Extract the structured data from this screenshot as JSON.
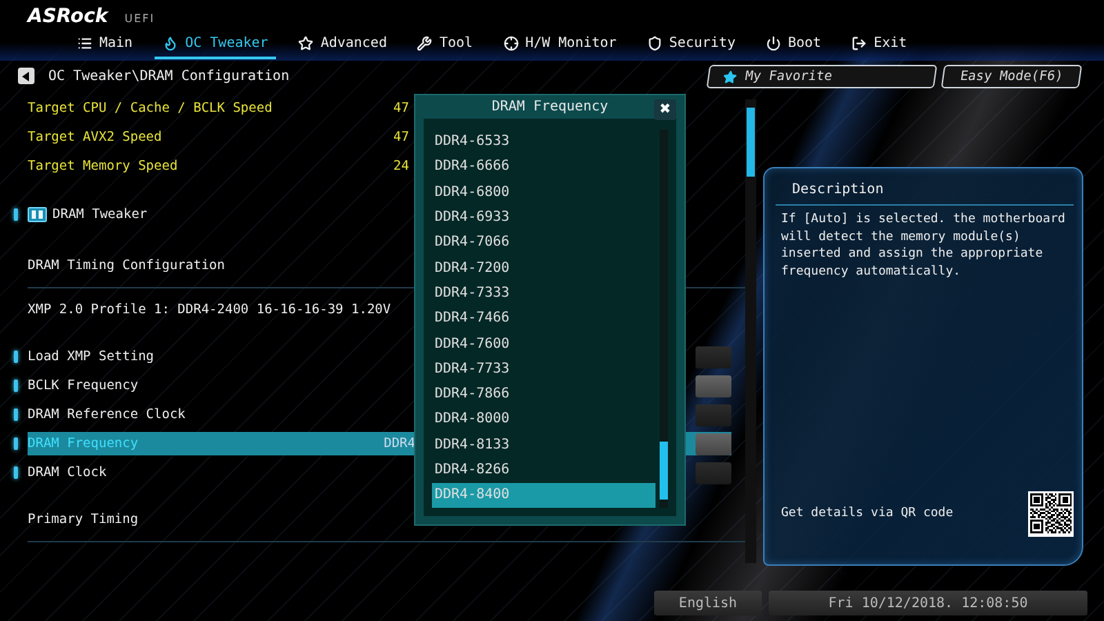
{
  "brand": {
    "logo": "ASRock",
    "product": "UEFI"
  },
  "tabs": [
    {
      "label": "Main",
      "selected": false
    },
    {
      "label": "OC Tweaker",
      "selected": true
    },
    {
      "label": "Advanced",
      "selected": false
    },
    {
      "label": "Tool",
      "selected": false
    },
    {
      "label": "H/W Monitor",
      "selected": false
    },
    {
      "label": "Security",
      "selected": false
    },
    {
      "label": "Boot",
      "selected": false
    },
    {
      "label": "Exit",
      "selected": false
    }
  ],
  "breadcrumb": "OC Tweaker\\DRAM Configuration",
  "favorite_button": "My Favorite",
  "easy_mode_button": "Easy Mode(F6)",
  "targets": [
    {
      "label": "Target CPU / Cache / BCLK Speed",
      "value": "47"
    },
    {
      "label": "Target AVX2 Speed",
      "value": "47"
    },
    {
      "label": "Target Memory Speed",
      "value": "24"
    }
  ],
  "submenu": {
    "label": "DRAM Tweaker"
  },
  "section_title": "DRAM Timing Configuration",
  "xmp_info": "XMP 2.0 Profile 1: DDR4-2400 16-16-16-39 1.20V",
  "settings": [
    {
      "label": "Load XMP Setting",
      "selected": false
    },
    {
      "label": "BCLK Frequency",
      "selected": false
    },
    {
      "label": "DRAM Reference Clock",
      "selected": false
    },
    {
      "label": "DRAM Frequency",
      "value": "DDR4",
      "selected": true
    },
    {
      "label": "DRAM Clock",
      "selected": false
    }
  ],
  "subsection_title": "Primary Timing",
  "description": {
    "title": "Description",
    "text": "If [Auto] is selected. the motherboard will detect the memory module(s) inserted and assign the appropriate frequency automatically.",
    "qr_label": "Get details via QR code"
  },
  "dialog": {
    "title": "DRAM Frequency",
    "close": "✖",
    "options": [
      {
        "label": "DDR4-6533",
        "selected": false
      },
      {
        "label": "DDR4-6666",
        "selected": false
      },
      {
        "label": "DDR4-6800",
        "selected": false
      },
      {
        "label": "DDR4-6933",
        "selected": false
      },
      {
        "label": "DDR4-7066",
        "selected": false
      },
      {
        "label": "DDR4-7200",
        "selected": false
      },
      {
        "label": "DDR4-7333",
        "selected": false
      },
      {
        "label": "DDR4-7466",
        "selected": false
      },
      {
        "label": "DDR4-7600",
        "selected": false
      },
      {
        "label": "DDR4-7733",
        "selected": false
      },
      {
        "label": "DDR4-7866",
        "selected": false
      },
      {
        "label": "DDR4-8000",
        "selected": false
      },
      {
        "label": "DDR4-8133",
        "selected": false
      },
      {
        "label": "DDR4-8266",
        "selected": false
      },
      {
        "label": "DDR4-8400",
        "selected": true
      }
    ]
  },
  "status_bar": {
    "language": "English",
    "datetime": "Fri 10/12/2018. 12:08:50"
  }
}
